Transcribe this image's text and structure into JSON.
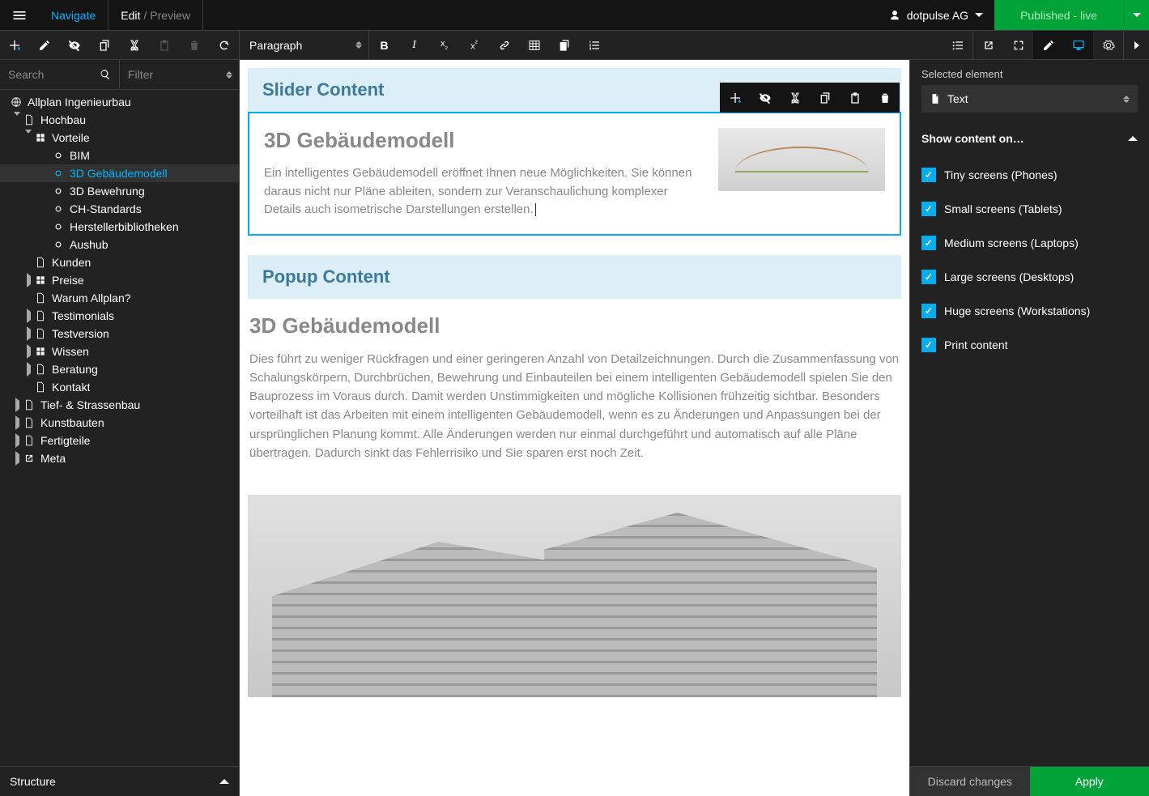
{
  "topbar": {
    "navigate": "Navigate",
    "edit": "Edit",
    "preview": "Preview",
    "user": "dotpulse AG",
    "publish": "Published - live"
  },
  "toolbar": {
    "format_select": "Paragraph"
  },
  "left": {
    "search_placeholder": "Search",
    "filter_placeholder": "Filter",
    "structure_label": "Structure",
    "tree": [
      {
        "label": "Allplan Ingenieurbau",
        "indent": 0,
        "icon": "globe",
        "toggle": "none"
      },
      {
        "label": "Hochbau",
        "indent": 1,
        "icon": "file",
        "toggle": "open"
      },
      {
        "label": "Vorteile",
        "indent": 2,
        "icon": "grid",
        "toggle": "open"
      },
      {
        "label": "BIM",
        "indent": 3,
        "icon": "circle",
        "toggle": "none"
      },
      {
        "label": "3D Gebäudemodell",
        "indent": 3,
        "icon": "circle",
        "toggle": "none",
        "active": true
      },
      {
        "label": "3D Bewehrung",
        "indent": 3,
        "icon": "circle",
        "toggle": "none"
      },
      {
        "label": "CH-Standards",
        "indent": 3,
        "icon": "circle",
        "toggle": "none"
      },
      {
        "label": "Herstellerbibliotheken",
        "indent": 3,
        "icon": "circle",
        "toggle": "none"
      },
      {
        "label": "Aushub",
        "indent": 3,
        "icon": "circle",
        "toggle": "none"
      },
      {
        "label": "Kunden",
        "indent": 2,
        "icon": "file",
        "toggle": "blank"
      },
      {
        "label": "Preise",
        "indent": 2,
        "icon": "grid",
        "toggle": "closed"
      },
      {
        "label": "Warum Allplan?",
        "indent": 2,
        "icon": "file",
        "toggle": "blank"
      },
      {
        "label": "Testimonials",
        "indent": 2,
        "icon": "file",
        "toggle": "closed"
      },
      {
        "label": "Testversion",
        "indent": 2,
        "icon": "file",
        "toggle": "closed"
      },
      {
        "label": "Wissen",
        "indent": 2,
        "icon": "grid",
        "toggle": "closed"
      },
      {
        "label": "Beratung",
        "indent": 2,
        "icon": "file",
        "toggle": "closed"
      },
      {
        "label": "Kontakt",
        "indent": 2,
        "icon": "file",
        "toggle": "blank"
      },
      {
        "label": "Tief- & Strassenbau",
        "indent": 1,
        "icon": "file",
        "toggle": "closed"
      },
      {
        "label": "Kunstbauten",
        "indent": 1,
        "icon": "file",
        "toggle": "closed"
      },
      {
        "label": "Fertigteile",
        "indent": 1,
        "icon": "file",
        "toggle": "closed"
      },
      {
        "label": "Meta",
        "indent": 1,
        "icon": "link",
        "toggle": "closed"
      }
    ]
  },
  "content": {
    "slider_header": "Slider Content",
    "block1_title": "3D Gebäudemodell",
    "block1_para": "Ein intelligentes Gebäudemodell eröffnet Ihnen neue Möglichkeiten. Sie können daraus nicht nur Pläne ableiten, sondern zur Veranschaulichung komplexer Details auch isometrische Darstellungen erstellen.",
    "popup_header": "Popup Content",
    "popup_title": "3D Gebäudemodell",
    "popup_para": "Dies führt zu weniger Rückfragen und einer geringeren Anzahl von Detailzeichnungen. Durch die Zusammenfassung von Schalungskörpern, Durchbrüchen, Bewehrung und Einbauteilen bei einem intelligenten Gebäudemodell spielen Sie den Bauprozess im Voraus durch. Damit werden Unstimmigkeiten und mögliche Kollisionen frühzeitig sichtbar. Besonders vorteilhaft ist das Arbeiten mit einem intelligenten Gebäudemodell, wenn es zu Änderungen und Anpassungen bei der ursprünglichen Planung kommt. Alle Änderungen werden nur einmal durchgeführt und automatisch auf alle Pläne übertragen. Dadurch sinkt das Fehlerrisiko und Sie sparen erst noch Zeit."
  },
  "right": {
    "selected_label": "Selected element",
    "selected_value": "Text",
    "show_header": "Show content on…",
    "checks": [
      "Tiny screens (Phones)",
      "Small screens (Tablets)",
      "Medium screens (Laptops)",
      "Large screens (Desktops)",
      "Huge screens (Workstations)",
      "Print content"
    ],
    "discard": "Discard changes",
    "apply": "Apply"
  }
}
